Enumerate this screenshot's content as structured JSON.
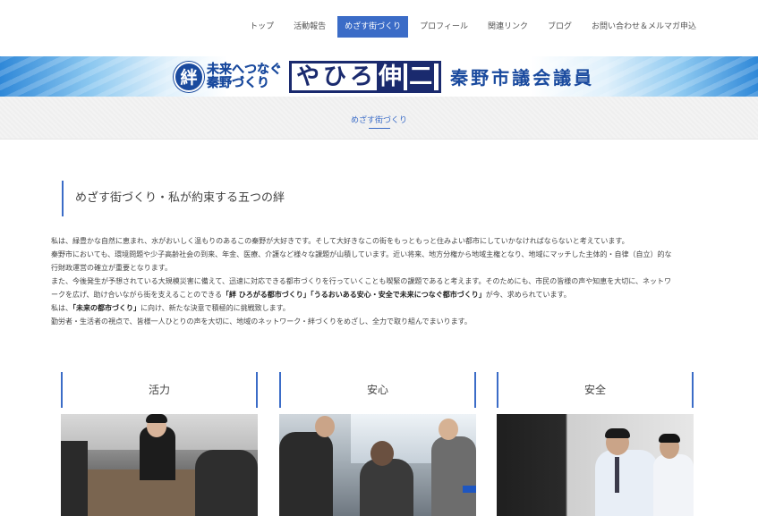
{
  "nav": {
    "items": [
      {
        "label": "トップ",
        "active": false
      },
      {
        "label": "活動報告",
        "active": false
      },
      {
        "label": "めざす街づくり",
        "active": true
      },
      {
        "label": "プロフィール",
        "active": false
      },
      {
        "label": "関連リンク",
        "active": false
      },
      {
        "label": "ブログ",
        "active": false
      },
      {
        "label": "お問い合わせ＆メルマガ申込",
        "active": false
      }
    ]
  },
  "banner": {
    "kizuna": "絆",
    "tagline_line1": "未来へつなぐ",
    "tagline_line2": "秦野づくり",
    "name_chars": [
      "や",
      "ひ",
      "ろ",
      "伸",
      "二"
    ],
    "subtitle": "秦野市議会議員"
  },
  "page": {
    "breadcrumb_title": "めざす街づくり",
    "heading": "めざす街づくり・私が約束する五つの絆"
  },
  "body": {
    "line1": "私は、緑豊かな自然に恵まれ、水がおいしく温もりのあるこの秦野が大好きです。そして大好きなこの街をもっともっと住みよい都市にしていかなければならないと考えています。",
    "line2": "秦野市においても、環境問題や少子高齢社会の到来、年金、医療、介護など様々な課題が山積しています。近い将来、地方分権から地域主権となり、地域にマッチした主体的・自律（自立）的な",
    "line3": "行財政運営の確立が重要となります。",
    "line4": "また、今後発生が予想されている大規模災害に備えて、迅速に対応できる都市づくりを行っていくことも喫緊の課題であると考えます。そのためにも、市民の皆様の声や知恵を大切に、ネットワ",
    "line5_a": "ークを広げ、助け合いながら街を支えることのできる",
    "line5_b": "「絆 ひろがる都市づくり」「うるおいある安心・安全で未来につなぐ都市づくり」",
    "line5_c": "が今、求められています。",
    "line6_a": "私は、",
    "line6_b": "「未来の都市づくり」",
    "line6_c": "に向け、新たな決意で積極的に挑戦致します。",
    "line7": "勤労者・生活者の視点で、皆様一人ひとりの声を大切に、地域のネットワーク・絆づくりをめざし、全力で取り組んでまいります。"
  },
  "cards": [
    {
      "title": "活力"
    },
    {
      "title": "安心"
    },
    {
      "title": "安全"
    }
  ],
  "colors": {
    "accent": "#3b6cc7",
    "brand_navy": "#1a2a6e"
  }
}
